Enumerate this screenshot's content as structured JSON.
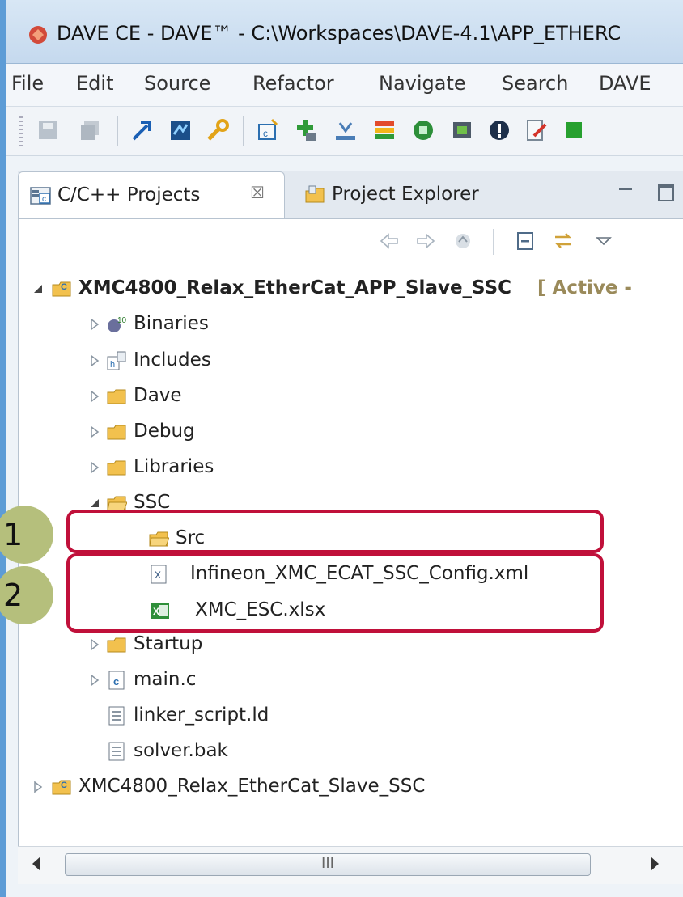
{
  "window": {
    "title": "DAVE CE - DAVE™ - C:\\Workspaces\\DAVE-4.1\\APP_ETHERC"
  },
  "menu": [
    "File",
    "Edit",
    "Source",
    "Refactor",
    "Navigate",
    "Search",
    "DAVE"
  ],
  "toolbar": {
    "icons": [
      "save-icon",
      "save-all-icon",
      "build-icon",
      "dave-generate-icon",
      "wrench-icon",
      "new-c-project-icon",
      "add-app-icon",
      "import-icon",
      "layers-icon",
      "green-chip-icon",
      "memory-icon",
      "alert-icon",
      "edit-icon",
      "chip-icon"
    ]
  },
  "tabs": {
    "projects": "C/C++ Projects",
    "projects_close": "☒",
    "explorer": "Project Explorer"
  },
  "tree": {
    "project": "XMC4800_Relax_EtherCat_APP_Slave_SSC",
    "active_tag": "[ Active -",
    "children": {
      "binaries": "Binaries",
      "includes": "Includes",
      "dave": "Dave",
      "debug": "Debug",
      "libraries": "Libraries",
      "ssc": "SSC",
      "src": "Src",
      "config_xml": "Infineon_XMC_ECAT_SSC_Config.xml",
      "xlsx": "XMC_ESC.xlsx",
      "startup": "Startup",
      "main_c": "main.c",
      "linker": "linker_script.ld",
      "solver": "solver.bak"
    },
    "second_project": "XMC4800_Relax_EtherCat_Slave_SSC"
  },
  "callouts": {
    "one": "1",
    "two": "2",
    "box_color": "#c0103a",
    "badge_color": "#b5bf7c"
  },
  "scrollbar": {
    "grip": "III"
  }
}
